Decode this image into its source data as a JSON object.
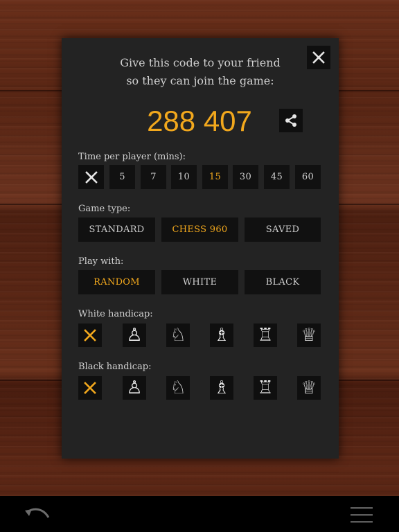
{
  "intro": {
    "line1": "Give this code to your friend",
    "line2": "so they can join the game:"
  },
  "code": "288 407",
  "time": {
    "label": "Time per player (mins):",
    "options": [
      "5",
      "7",
      "10",
      "15",
      "30",
      "45",
      "60"
    ],
    "selected": "15"
  },
  "game_type": {
    "label": "Game type:",
    "options": [
      "STANDARD",
      "CHESS 960",
      "SAVED"
    ],
    "selected": "CHESS 960"
  },
  "play_with": {
    "label": "Play with:",
    "options": [
      "RANDOM",
      "WHITE",
      "BLACK"
    ],
    "selected": "RANDOM"
  },
  "white_handicap": {
    "label": "White handicap:",
    "selected": "none"
  },
  "black_handicap": {
    "label": "Black handicap:",
    "selected": "none"
  },
  "icons": {
    "close": "close-icon",
    "share": "share-icon",
    "undo": "undo-icon",
    "menu": "hamburger-menu-icon",
    "pieces": [
      "none-icon",
      "pawn-icon",
      "knight-icon",
      "bishop-icon",
      "rook-icon",
      "queen-icon"
    ]
  },
  "colors": {
    "accent": "#f2a81d",
    "panel": "#232323",
    "button": "#111111",
    "text": "#cfcfcf"
  }
}
